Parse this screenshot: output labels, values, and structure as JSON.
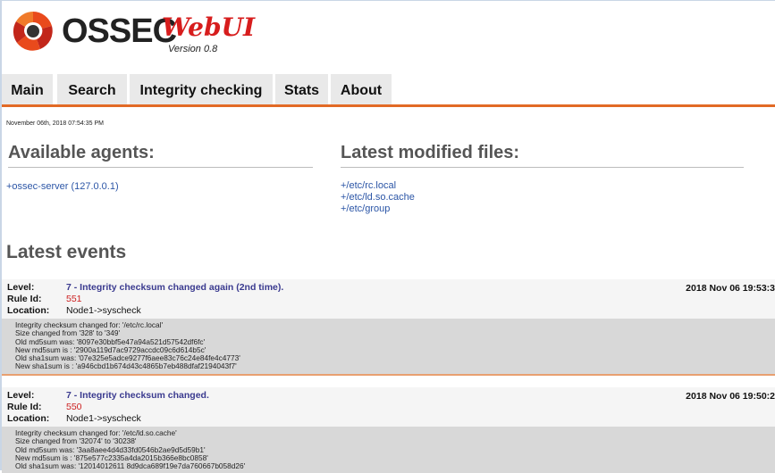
{
  "header": {
    "logo_ossec": "OSSEC",
    "logo_webui": "WebUI",
    "version": "Version 0.8"
  },
  "nav": {
    "items": [
      {
        "label": "Main"
      },
      {
        "label": "Search"
      },
      {
        "label": "Integrity checking"
      },
      {
        "label": "Stats"
      },
      {
        "label": "About"
      }
    ]
  },
  "date": "November 06th, 2018 07:54:35 PM",
  "agents": {
    "title": "Available agents:",
    "items": [
      "+ossec-server (127.0.0.1)"
    ]
  },
  "files": {
    "title": "Latest modified files:",
    "items": [
      "+/etc/rc.local",
      "+/etc/ld.so.cache",
      "+/etc/group"
    ]
  },
  "events": {
    "title": "Latest events",
    "labels": {
      "level": "Level:",
      "rule": "Rule Id:",
      "location": "Location:"
    },
    "items": [
      {
        "level": "7 - Integrity checksum changed again (2nd time).",
        "rule_id": "551",
        "location": "Node1->syscheck",
        "time": "2018 Nov 06 19:53:3",
        "lines": [
          "Integrity checksum changed for: '/etc/rc.local'",
          "Size changed from '328' to '349'",
          "Old md5sum was: '8097e30bbf5e47a94a521d57542df6fc'",
          "New md5sum is : '2900a119d7ac9729accdc09c6d614b5c'",
          "Old sha1sum was: '07e325e5adce9277f6aee83c76c24e84fe4c4773'",
          "New sha1sum is : 'a946cbd1b674d43c4865b7eb488dfaf2194043f7'"
        ]
      },
      {
        "level": "7 - Integrity checksum changed.",
        "rule_id": "550",
        "location": "Node1->syscheck",
        "time": "2018 Nov 06 19:50:2",
        "lines": [
          "Integrity checksum changed for: '/etc/ld.so.cache'",
          "Size changed from '32074' to '30238'",
          "Old md5sum was: '3aa8aee4d4d33fd0546b2ae9d5d59b1'",
          "New md5sum is : '875e577c2335a4da2015b366e8bc0858'",
          "Old sha1sum was: '12014012611 8d9dca689f19e7da760667b058d26'"
        ]
      }
    ]
  },
  "colors": {
    "accent": "#e26a25",
    "link": "#2b55a6",
    "rule": "#cc1f1f",
    "desc": "#3a3a8f"
  },
  "icons": {
    "logo": "ossec-logo-icon"
  }
}
